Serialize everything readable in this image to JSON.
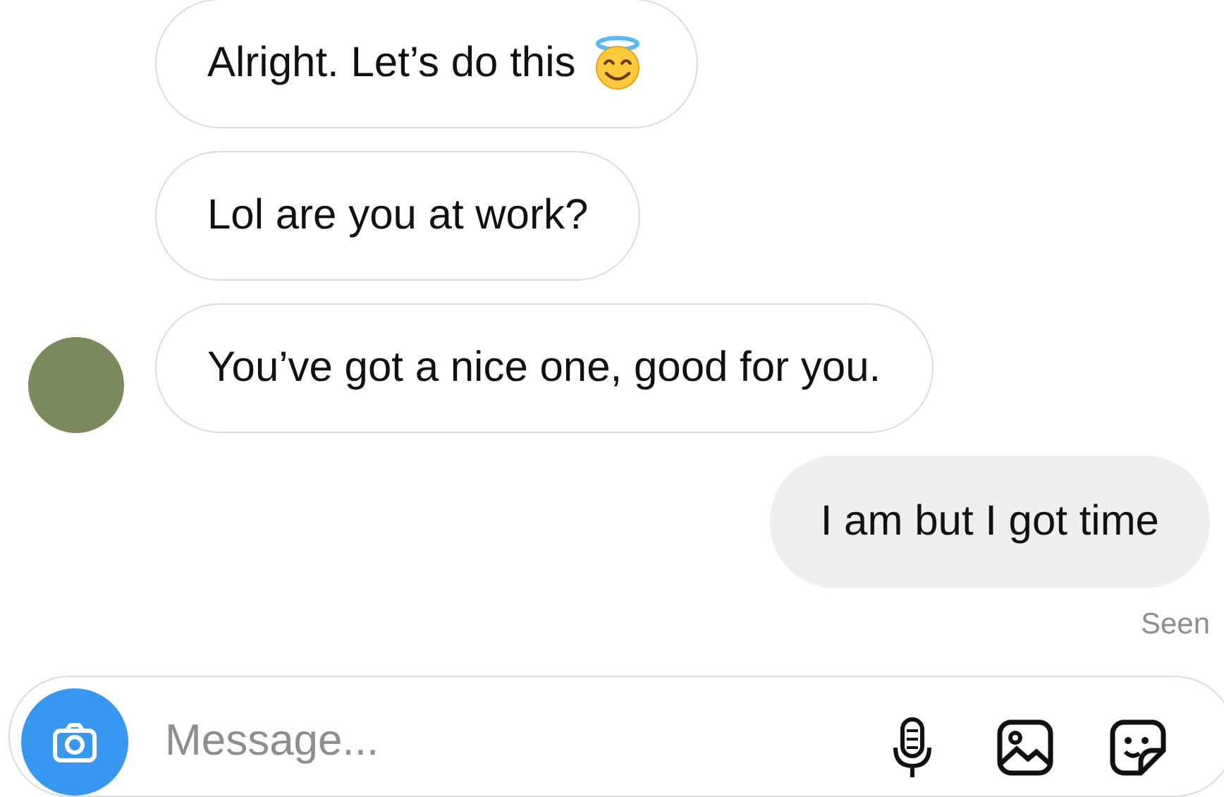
{
  "messages": [
    {
      "kind": "received",
      "text": "Alright. Let’s do this",
      "halo_emoji": true,
      "show_avatar": false
    },
    {
      "kind": "received",
      "text": "Lol are you at work?",
      "halo_emoji": false,
      "show_avatar": false
    },
    {
      "kind": "received",
      "text": "You’ve got a nice one, good for you.",
      "halo_emoji": false,
      "show_avatar": true
    },
    {
      "kind": "sent",
      "text": "I am but I got time",
      "halo_emoji": false,
      "show_avatar": false
    }
  ],
  "status": "Seen",
  "composer": {
    "placeholder": "Message..."
  }
}
